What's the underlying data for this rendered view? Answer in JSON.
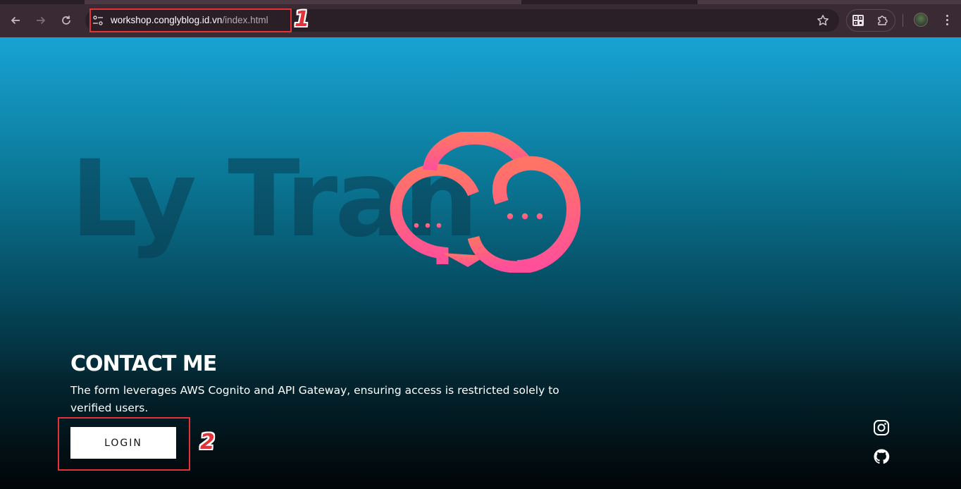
{
  "browser": {
    "url_host": "workshop.conglyblog.id.vn",
    "url_path": "/index.html",
    "icons": {
      "back": "back-arrow-icon",
      "forward": "forward-arrow-icon",
      "reload": "reload-icon",
      "site_info": "site-info-icon",
      "bookmark": "star-icon",
      "qr_extension": "qr-code-icon",
      "extensions": "puzzle-icon",
      "menu": "kebab-menu-icon"
    }
  },
  "page": {
    "watermark": "Ly Tran",
    "contact": {
      "title": "CONTACT ME",
      "description": "The form leverages AWS Cognito and API Gateway, ensuring access is restricted solely to verified users.",
      "login_label": "LOGIN"
    },
    "social": [
      "instagram-icon",
      "github-icon"
    ]
  },
  "annotations": {
    "label_1": "1",
    "label_2": "2",
    "color": "#e4323a"
  },
  "colors": {
    "logo_gradient_top": "#ff7466",
    "logo_gradient_bottom": "#ff4f9a",
    "background_top": "#18a3d4",
    "background_bottom": "#010507"
  }
}
